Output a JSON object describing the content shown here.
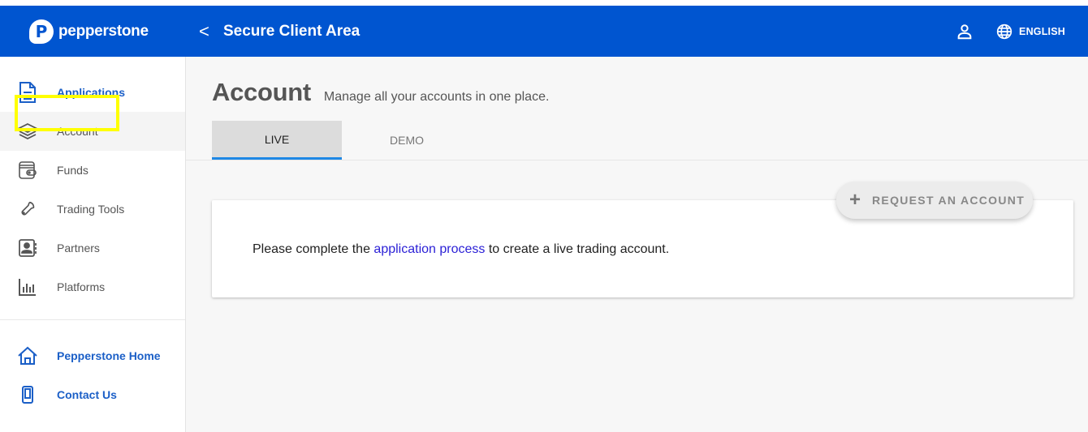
{
  "header": {
    "brand": "pepperstone",
    "logo_glyph": "P",
    "back_glyph": "<",
    "title": "Secure Client Area",
    "language": "ENGLISH"
  },
  "sidebar": {
    "items": [
      {
        "label": "Applications",
        "icon": "document-icon",
        "style": "blue"
      },
      {
        "label": "Account",
        "icon": "layers-icon",
        "active": true
      },
      {
        "label": "Funds",
        "icon": "wallet-icon",
        "highlighted": true
      },
      {
        "label": "Trading Tools",
        "icon": "wrench-icon"
      },
      {
        "label": "Partners",
        "icon": "contact-book-icon"
      },
      {
        "label": "Platforms",
        "icon": "bar-chart-icon"
      }
    ],
    "footer_items": [
      {
        "label": "Pepperstone Home",
        "icon": "home-icon",
        "style": "blue"
      },
      {
        "label": "Contact Us",
        "icon": "phone-icon",
        "style": "blue"
      }
    ]
  },
  "main": {
    "title": "Account",
    "subtitle": "Manage all your accounts in one place.",
    "tabs": [
      {
        "label": "LIVE",
        "active": true
      },
      {
        "label": "DEMO",
        "active": false
      }
    ],
    "request_button": {
      "icon": "plus-icon",
      "glyph": "+",
      "label": "REQUEST AN ACCOUNT"
    },
    "card": {
      "text_before": "Please complete the ",
      "link_text": "application process",
      "text_after": " to create a live trading account."
    }
  },
  "colors": {
    "header_bg": "#0055d0",
    "nav_blue": "#1b5fc7",
    "tab_indicator": "#1e88e5",
    "link": "#2a1fd6",
    "highlight_box": "#ffff00"
  }
}
